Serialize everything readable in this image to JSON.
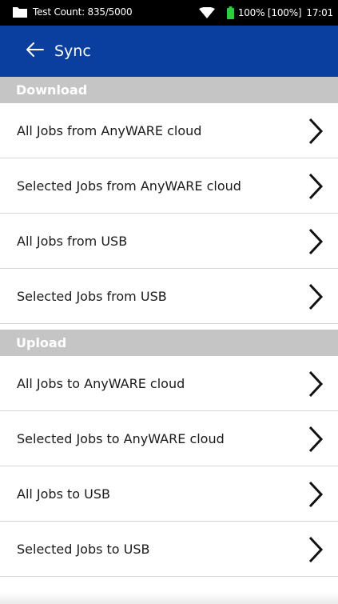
{
  "status_bar": {
    "test_count": "Test Count: 835/5000",
    "battery": "100% [100%]",
    "time": "17:01",
    "icons": [
      "folder-icon",
      "wifi-icon",
      "battery-icon"
    ],
    "battery_color": "#2ecc40"
  },
  "header": {
    "title": "Sync",
    "back_icon": "arrow-left-icon",
    "color": "#0a3fa0"
  },
  "sections": {
    "download": {
      "title": "Download",
      "items": [
        {
          "label": "All Jobs from AnyWARE cloud"
        },
        {
          "label": "Selected Jobs from AnyWARE cloud"
        },
        {
          "label": "All Jobs from USB"
        },
        {
          "label": "Selected Jobs from USB"
        }
      ]
    },
    "upload": {
      "title": "Upload",
      "items": [
        {
          "label": "All Jobs to AnyWARE cloud"
        },
        {
          "label": "Selected Jobs to AnyWARE cloud"
        },
        {
          "label": "All Jobs to USB"
        },
        {
          "label": "Selected Jobs to USB"
        }
      ]
    }
  },
  "section_header_color": "#c5c5c5",
  "row_icon": "chevron-right-icon"
}
